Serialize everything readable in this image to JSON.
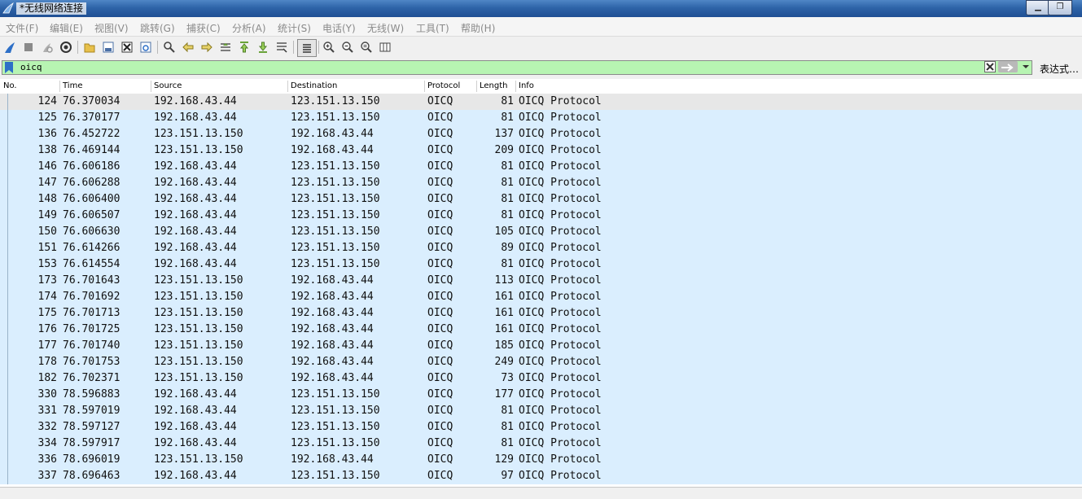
{
  "window": {
    "title": "*无线网络连接"
  },
  "menu": [
    "文件(F)",
    "编辑(E)",
    "视图(V)",
    "跳转(G)",
    "捕获(C)",
    "分析(A)",
    "统计(S)",
    "电话(Y)",
    "无线(W)",
    "工具(T)",
    "帮助(H)"
  ],
  "toolbar": {
    "icons": [
      "start-capture-icon",
      "stop-capture-icon",
      "restart-capture-icon",
      "capture-options-icon",
      "open-file-icon",
      "save-file-icon",
      "close-file-icon",
      "reload-file-icon",
      "find-packet-icon",
      "go-back-icon",
      "go-forward-icon",
      "go-to-packet-icon",
      "first-packet-icon",
      "last-packet-icon",
      "auto-scroll-icon",
      "colorize-icon",
      "zoom-in-icon",
      "zoom-out-icon",
      "zoom-normal-icon",
      "resize-columns-icon"
    ]
  },
  "filter": {
    "value": "oicq",
    "expression_label": "表达式…",
    "accent": "#b7f4b2"
  },
  "columns": {
    "no": "No.",
    "time": "Time",
    "source": "Source",
    "destination": "Destination",
    "protocol": "Protocol",
    "length": "Length",
    "info": "Info"
  },
  "packets": [
    {
      "no": "124",
      "time": "76.370034",
      "src": "192.168.43.44",
      "dst": "123.151.13.150",
      "proto": "OICQ",
      "len": "81",
      "info": "OICQ Protocol"
    },
    {
      "no": "125",
      "time": "76.370177",
      "src": "192.168.43.44",
      "dst": "123.151.13.150",
      "proto": "OICQ",
      "len": "81",
      "info": "OICQ Protocol"
    },
    {
      "no": "136",
      "time": "76.452722",
      "src": "123.151.13.150",
      "dst": "192.168.43.44",
      "proto": "OICQ",
      "len": "137",
      "info": "OICQ Protocol"
    },
    {
      "no": "138",
      "time": "76.469144",
      "src": "123.151.13.150",
      "dst": "192.168.43.44",
      "proto": "OICQ",
      "len": "209",
      "info": "OICQ Protocol"
    },
    {
      "no": "146",
      "time": "76.606186",
      "src": "192.168.43.44",
      "dst": "123.151.13.150",
      "proto": "OICQ",
      "len": "81",
      "info": "OICQ Protocol"
    },
    {
      "no": "147",
      "time": "76.606288",
      "src": "192.168.43.44",
      "dst": "123.151.13.150",
      "proto": "OICQ",
      "len": "81",
      "info": "OICQ Protocol"
    },
    {
      "no": "148",
      "time": "76.606400",
      "src": "192.168.43.44",
      "dst": "123.151.13.150",
      "proto": "OICQ",
      "len": "81",
      "info": "OICQ Protocol"
    },
    {
      "no": "149",
      "time": "76.606507",
      "src": "192.168.43.44",
      "dst": "123.151.13.150",
      "proto": "OICQ",
      "len": "81",
      "info": "OICQ Protocol"
    },
    {
      "no": "150",
      "time": "76.606630",
      "src": "192.168.43.44",
      "dst": "123.151.13.150",
      "proto": "OICQ",
      "len": "105",
      "info": "OICQ Protocol"
    },
    {
      "no": "151",
      "time": "76.614266",
      "src": "192.168.43.44",
      "dst": "123.151.13.150",
      "proto": "OICQ",
      "len": "89",
      "info": "OICQ Protocol"
    },
    {
      "no": "153",
      "time": "76.614554",
      "src": "192.168.43.44",
      "dst": "123.151.13.150",
      "proto": "OICQ",
      "len": "81",
      "info": "OICQ Protocol"
    },
    {
      "no": "173",
      "time": "76.701643",
      "src": "123.151.13.150",
      "dst": "192.168.43.44",
      "proto": "OICQ",
      "len": "113",
      "info": "OICQ Protocol"
    },
    {
      "no": "174",
      "time": "76.701692",
      "src": "123.151.13.150",
      "dst": "192.168.43.44",
      "proto": "OICQ",
      "len": "161",
      "info": "OICQ Protocol"
    },
    {
      "no": "175",
      "time": "76.701713",
      "src": "123.151.13.150",
      "dst": "192.168.43.44",
      "proto": "OICQ",
      "len": "161",
      "info": "OICQ Protocol"
    },
    {
      "no": "176",
      "time": "76.701725",
      "src": "123.151.13.150",
      "dst": "192.168.43.44",
      "proto": "OICQ",
      "len": "161",
      "info": "OICQ Protocol"
    },
    {
      "no": "177",
      "time": "76.701740",
      "src": "123.151.13.150",
      "dst": "192.168.43.44",
      "proto": "OICQ",
      "len": "185",
      "info": "OICQ Protocol"
    },
    {
      "no": "178",
      "time": "76.701753",
      "src": "123.151.13.150",
      "dst": "192.168.43.44",
      "proto": "OICQ",
      "len": "249",
      "info": "OICQ Protocol"
    },
    {
      "no": "182",
      "time": "76.702371",
      "src": "123.151.13.150",
      "dst": "192.168.43.44",
      "proto": "OICQ",
      "len": "73",
      "info": "OICQ Protocol"
    },
    {
      "no": "330",
      "time": "78.596883",
      "src": "192.168.43.44",
      "dst": "123.151.13.150",
      "proto": "OICQ",
      "len": "177",
      "info": "OICQ Protocol"
    },
    {
      "no": "331",
      "time": "78.597019",
      "src": "192.168.43.44",
      "dst": "123.151.13.150",
      "proto": "OICQ",
      "len": "81",
      "info": "OICQ Protocol"
    },
    {
      "no": "332",
      "time": "78.597127",
      "src": "192.168.43.44",
      "dst": "123.151.13.150",
      "proto": "OICQ",
      "len": "81",
      "info": "OICQ Protocol"
    },
    {
      "no": "334",
      "time": "78.597917",
      "src": "192.168.43.44",
      "dst": "123.151.13.150",
      "proto": "OICQ",
      "len": "81",
      "info": "OICQ Protocol"
    },
    {
      "no": "336",
      "time": "78.696019",
      "src": "123.151.13.150",
      "dst": "192.168.43.44",
      "proto": "OICQ",
      "len": "129",
      "info": "OICQ Protocol"
    },
    {
      "no": "337",
      "time": "78.696463",
      "src": "192.168.43.44",
      "dst": "123.151.13.150",
      "proto": "OICQ",
      "len": "97",
      "info": "OICQ Protocol"
    }
  ],
  "row_color": "#daeefe",
  "selected_row_color": "#e7e7e7"
}
